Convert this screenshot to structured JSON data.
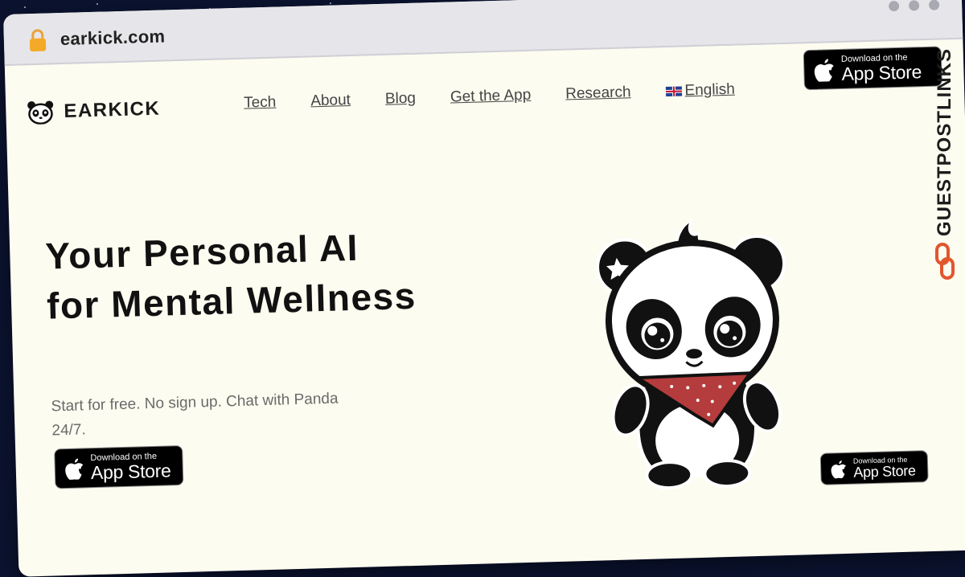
{
  "browser": {
    "url": "earkick.com"
  },
  "brand": {
    "name": "EARKICK"
  },
  "nav": {
    "items": [
      {
        "label": "Tech"
      },
      {
        "label": "About"
      },
      {
        "label": "Blog"
      },
      {
        "label": "Get the App"
      },
      {
        "label": "Research"
      },
      {
        "label": "English"
      }
    ]
  },
  "appstore": {
    "small": "Download on the",
    "big": "App Store"
  },
  "hero": {
    "title": "Your Personal AI for Mental Wellness",
    "subtitle": "Start for free. No sign up. Chat with Panda 24/7."
  },
  "watermark": {
    "text": "GUESTPOSTLINKS"
  },
  "icons": [
    "lock-icon",
    "panda-logo-icon",
    "uk-flag-icon",
    "apple-icon",
    "panda-illustration",
    "guestpostlinks-icon"
  ],
  "colors": {
    "page_bg": "#fdfcf0",
    "outer_bg": "#0b1330",
    "bandana": "#b43c3c",
    "watermark_accent": "#e2562e"
  }
}
